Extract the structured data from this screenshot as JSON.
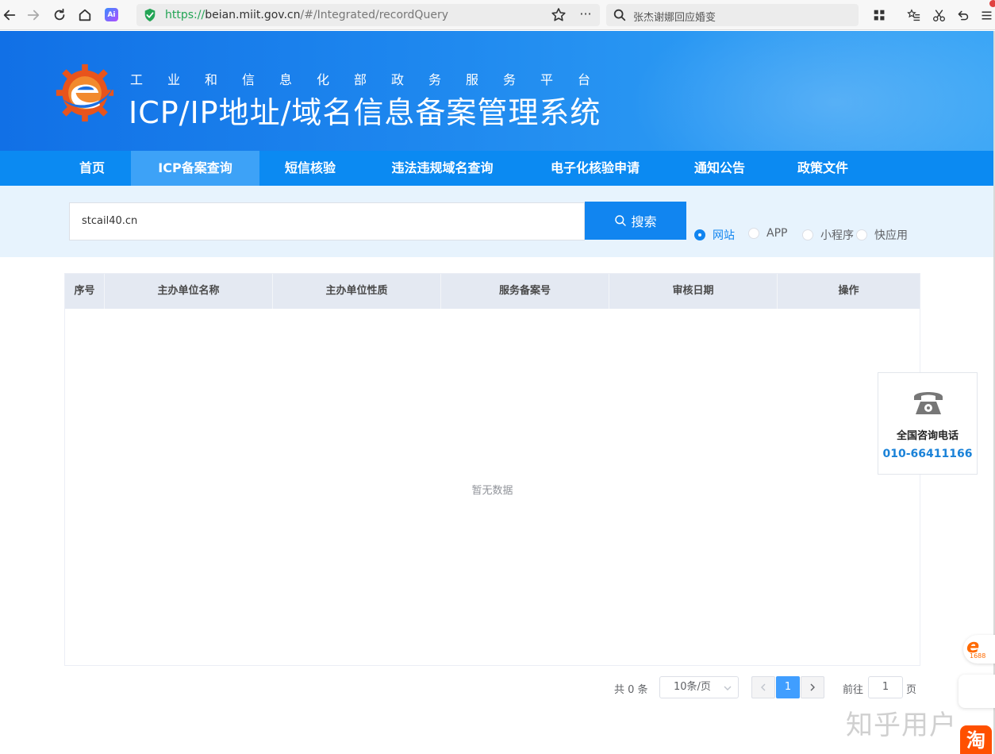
{
  "browser": {
    "url_protocol": "https://",
    "url_host": "beian.miit.gov.cn",
    "url_path": "/#/Integrated/recordQuery",
    "search_text": "张杰谢娜回应婚变",
    "ai_label": "Ai"
  },
  "header": {
    "platform_name": "工业和信息化部政务服务平台",
    "system_title": "ICP/IP地址/域名信息备案管理系统"
  },
  "menu": {
    "items": [
      "首页",
      "ICP备案查询",
      "短信核验",
      "违法违规域名查询",
      "电子化核验申请",
      "通知公告",
      "政策文件"
    ],
    "active": "ICP备案查询"
  },
  "search": {
    "query_value": "stcail40.cn",
    "button_label": "搜索",
    "types": [
      "网站",
      "APP",
      "小程序",
      "快应用"
    ],
    "selected_type": "网站"
  },
  "table": {
    "columns": [
      "序号",
      "主办单位名称",
      "主办单位性质",
      "服务备案号",
      "审核日期",
      "操作"
    ],
    "empty_text": "暂无数据"
  },
  "pagination": {
    "total_text": "共 0 条",
    "page_size": "10条/页",
    "current_page": "1",
    "goto_label": "前往",
    "goto_value": "1",
    "page_suffix": "页"
  },
  "hotline": {
    "label": "全国咨询电话",
    "number": "010-66411166"
  },
  "overlay": {
    "badge_1688_text": "1688",
    "taobao_text": "淘",
    "watermark": "知乎用户"
  },
  "colors": {
    "primary": "#1185f0",
    "menu_bg": "#0b8af2",
    "menu_active": "#3da2f7",
    "search_area_bg": "#e7f3fd",
    "pager_active": "#409eff"
  }
}
